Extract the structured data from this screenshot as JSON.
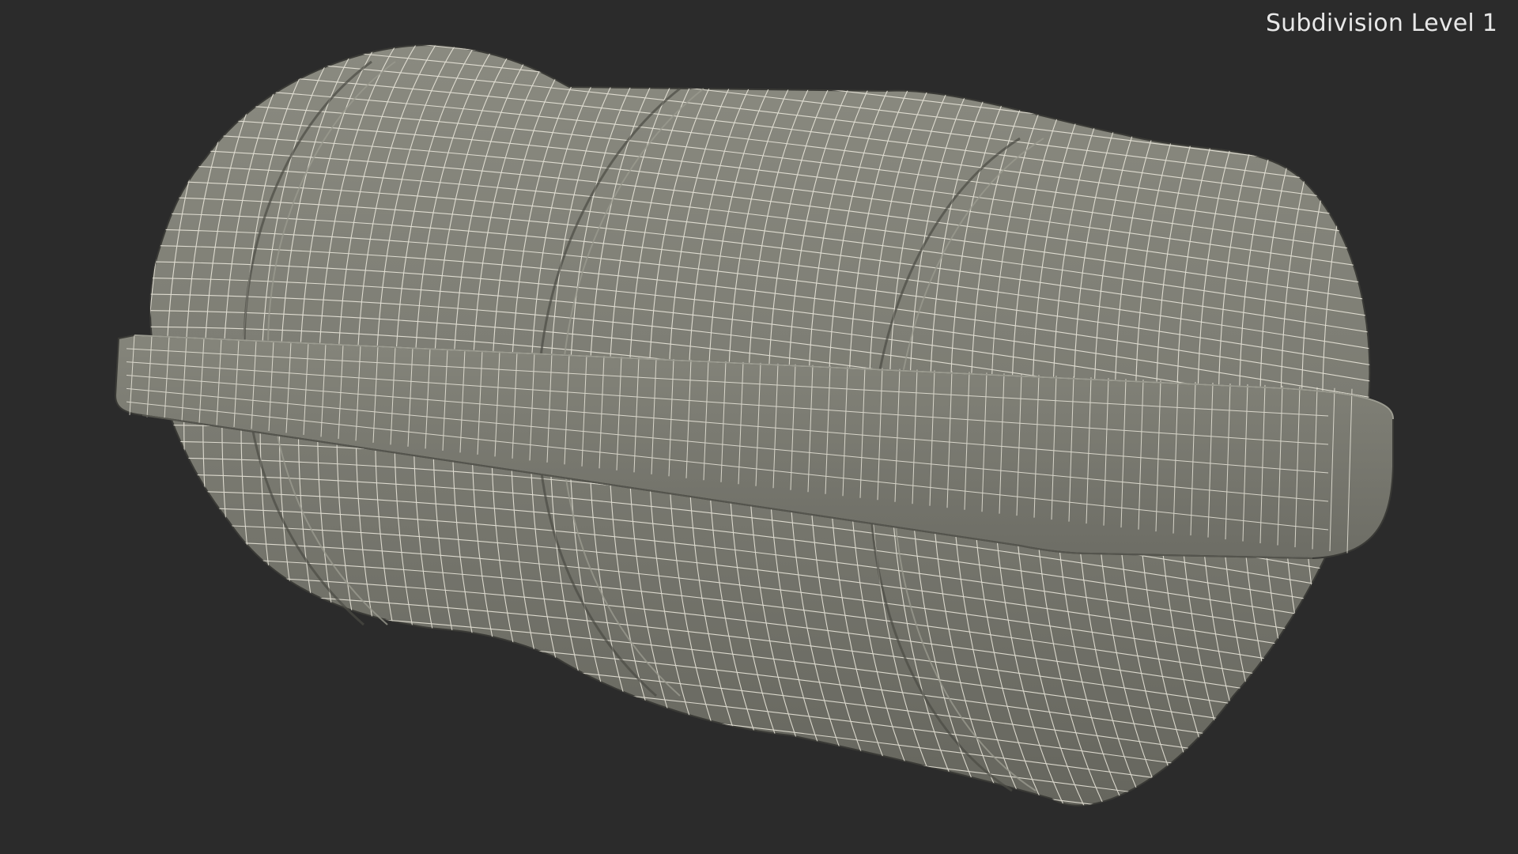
{
  "viewport": {
    "overlay_label": "Subdivision Level 1",
    "background_color": "#2b2b2b",
    "mesh_fill_color": "#7d7d73",
    "mesh_shadow_color": "#5f5f57",
    "wire_color": "#f2f0e6"
  },
  "model": {
    "display_mode": "wireframe-on-shaded"
  }
}
